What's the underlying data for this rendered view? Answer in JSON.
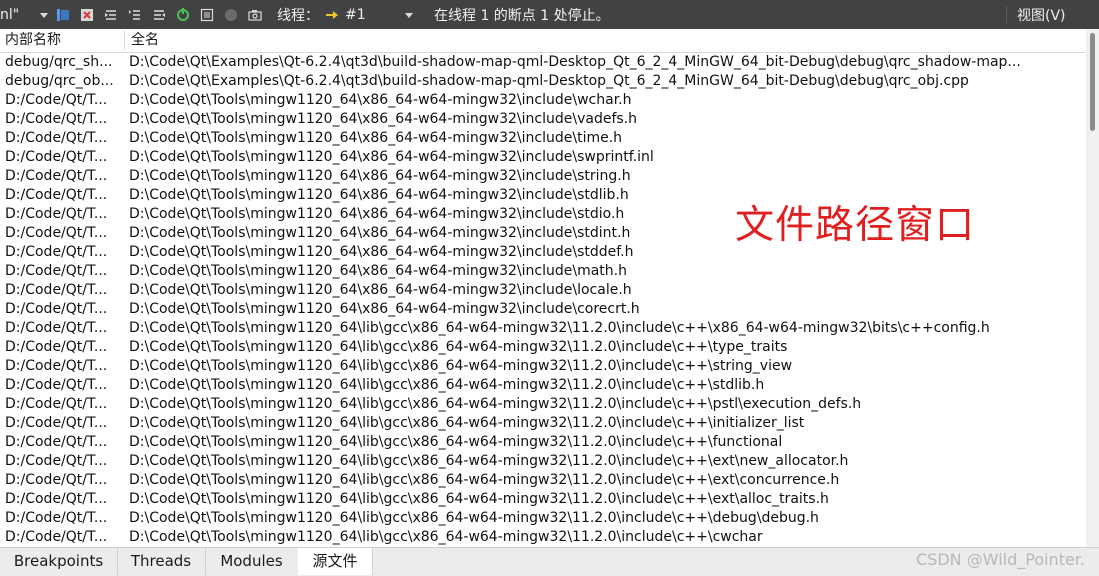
{
  "toolbar": {
    "left_fragment": "nl\"",
    "thread_label": "线程：",
    "thread_value": "#1",
    "status": "在线程 1 的断点 1 处停止。",
    "view_menu": "视图(V)"
  },
  "columns": {
    "internal_name": "内部名称",
    "full_name": "全名"
  },
  "rows": [
    {
      "short": "debug/qrc_sh...",
      "full": "D:\\Code\\Qt\\Examples\\Qt-6.2.4\\qt3d\\build-shadow-map-qml-Desktop_Qt_6_2_4_MinGW_64_bit-Debug\\debug\\qrc_shadow-map..."
    },
    {
      "short": "debug/qrc_ob...",
      "full": "D:\\Code\\Qt\\Examples\\Qt-6.2.4\\qt3d\\build-shadow-map-qml-Desktop_Qt_6_2_4_MinGW_64_bit-Debug\\debug\\qrc_obj.cpp"
    },
    {
      "short": "D:/Code/Qt/T...",
      "full": "D:\\Code\\Qt\\Tools\\mingw1120_64\\x86_64-w64-mingw32\\include\\wchar.h"
    },
    {
      "short": "D:/Code/Qt/T...",
      "full": "D:\\Code\\Qt\\Tools\\mingw1120_64\\x86_64-w64-mingw32\\include\\vadefs.h"
    },
    {
      "short": "D:/Code/Qt/T...",
      "full": "D:\\Code\\Qt\\Tools\\mingw1120_64\\x86_64-w64-mingw32\\include\\time.h"
    },
    {
      "short": "D:/Code/Qt/T...",
      "full": "D:\\Code\\Qt\\Tools\\mingw1120_64\\x86_64-w64-mingw32\\include\\swprintf.inl"
    },
    {
      "short": "D:/Code/Qt/T...",
      "full": "D:\\Code\\Qt\\Tools\\mingw1120_64\\x86_64-w64-mingw32\\include\\string.h"
    },
    {
      "short": "D:/Code/Qt/T...",
      "full": "D:\\Code\\Qt\\Tools\\mingw1120_64\\x86_64-w64-mingw32\\include\\stdlib.h"
    },
    {
      "short": "D:/Code/Qt/T...",
      "full": "D:\\Code\\Qt\\Tools\\mingw1120_64\\x86_64-w64-mingw32\\include\\stdio.h"
    },
    {
      "short": "D:/Code/Qt/T...",
      "full": "D:\\Code\\Qt\\Tools\\mingw1120_64\\x86_64-w64-mingw32\\include\\stdint.h"
    },
    {
      "short": "D:/Code/Qt/T...",
      "full": "D:\\Code\\Qt\\Tools\\mingw1120_64\\x86_64-w64-mingw32\\include\\stddef.h"
    },
    {
      "short": "D:/Code/Qt/T...",
      "full": "D:\\Code\\Qt\\Tools\\mingw1120_64\\x86_64-w64-mingw32\\include\\math.h"
    },
    {
      "short": "D:/Code/Qt/T...",
      "full": "D:\\Code\\Qt\\Tools\\mingw1120_64\\x86_64-w64-mingw32\\include\\locale.h"
    },
    {
      "short": "D:/Code/Qt/T...",
      "full": "D:\\Code\\Qt\\Tools\\mingw1120_64\\x86_64-w64-mingw32\\include\\corecrt.h"
    },
    {
      "short": "D:/Code/Qt/T...",
      "full": "D:\\Code\\Qt\\Tools\\mingw1120_64\\lib\\gcc\\x86_64-w64-mingw32\\11.2.0\\include\\c++\\x86_64-w64-mingw32\\bits\\c++config.h"
    },
    {
      "short": "D:/Code/Qt/T...",
      "full": "D:\\Code\\Qt\\Tools\\mingw1120_64\\lib\\gcc\\x86_64-w64-mingw32\\11.2.0\\include\\c++\\type_traits"
    },
    {
      "short": "D:/Code/Qt/T...",
      "full": "D:\\Code\\Qt\\Tools\\mingw1120_64\\lib\\gcc\\x86_64-w64-mingw32\\11.2.0\\include\\c++\\string_view"
    },
    {
      "short": "D:/Code/Qt/T...",
      "full": "D:\\Code\\Qt\\Tools\\mingw1120_64\\lib\\gcc\\x86_64-w64-mingw32\\11.2.0\\include\\c++\\stdlib.h"
    },
    {
      "short": "D:/Code/Qt/T...",
      "full": "D:\\Code\\Qt\\Tools\\mingw1120_64\\lib\\gcc\\x86_64-w64-mingw32\\11.2.0\\include\\c++\\pstl\\execution_defs.h"
    },
    {
      "short": "D:/Code/Qt/T...",
      "full": "D:\\Code\\Qt\\Tools\\mingw1120_64\\lib\\gcc\\x86_64-w64-mingw32\\11.2.0\\include\\c++\\initializer_list"
    },
    {
      "short": "D:/Code/Qt/T...",
      "full": "D:\\Code\\Qt\\Tools\\mingw1120_64\\lib\\gcc\\x86_64-w64-mingw32\\11.2.0\\include\\c++\\functional"
    },
    {
      "short": "D:/Code/Qt/T...",
      "full": "D:\\Code\\Qt\\Tools\\mingw1120_64\\lib\\gcc\\x86_64-w64-mingw32\\11.2.0\\include\\c++\\ext\\new_allocator.h"
    },
    {
      "short": "D:/Code/Qt/T...",
      "full": "D:\\Code\\Qt\\Tools\\mingw1120_64\\lib\\gcc\\x86_64-w64-mingw32\\11.2.0\\include\\c++\\ext\\concurrence.h"
    },
    {
      "short": "D:/Code/Qt/T...",
      "full": "D:\\Code\\Qt\\Tools\\mingw1120_64\\lib\\gcc\\x86_64-w64-mingw32\\11.2.0\\include\\c++\\ext\\alloc_traits.h"
    },
    {
      "short": "D:/Code/Qt/T...",
      "full": "D:\\Code\\Qt\\Tools\\mingw1120_64\\lib\\gcc\\x86_64-w64-mingw32\\11.2.0\\include\\c++\\debug\\debug.h"
    },
    {
      "short": "D:/Code/Qt/T...",
      "full": "D:\\Code\\Qt\\Tools\\mingw1120_64\\lib\\gcc\\x86_64-w64-mingw32\\11.2.0\\include\\c++\\cwchar"
    }
  ],
  "overlay_text": "文件路径窗口",
  "tabs": [
    {
      "label": "Breakpoints"
    },
    {
      "label": "Threads"
    },
    {
      "label": "Modules"
    },
    {
      "label": "源文件",
      "active": true
    }
  ],
  "watermark": "CSDN @Wild_Pointer.",
  "colors": {
    "toolbar_bg": "#404244",
    "overlay_red": "#e02020",
    "tab_bar_bg": "#ececec"
  },
  "icons": [
    "dropdown-arrow-icon",
    "breakpoint-toggle-icon",
    "remove-breakpoint-icon",
    "step-list-icon",
    "step-into-list-icon",
    "step-out-list-icon",
    "refresh-icon",
    "memory-icon",
    "record-icon",
    "camera-icon",
    "thread-arrow-icon"
  ]
}
